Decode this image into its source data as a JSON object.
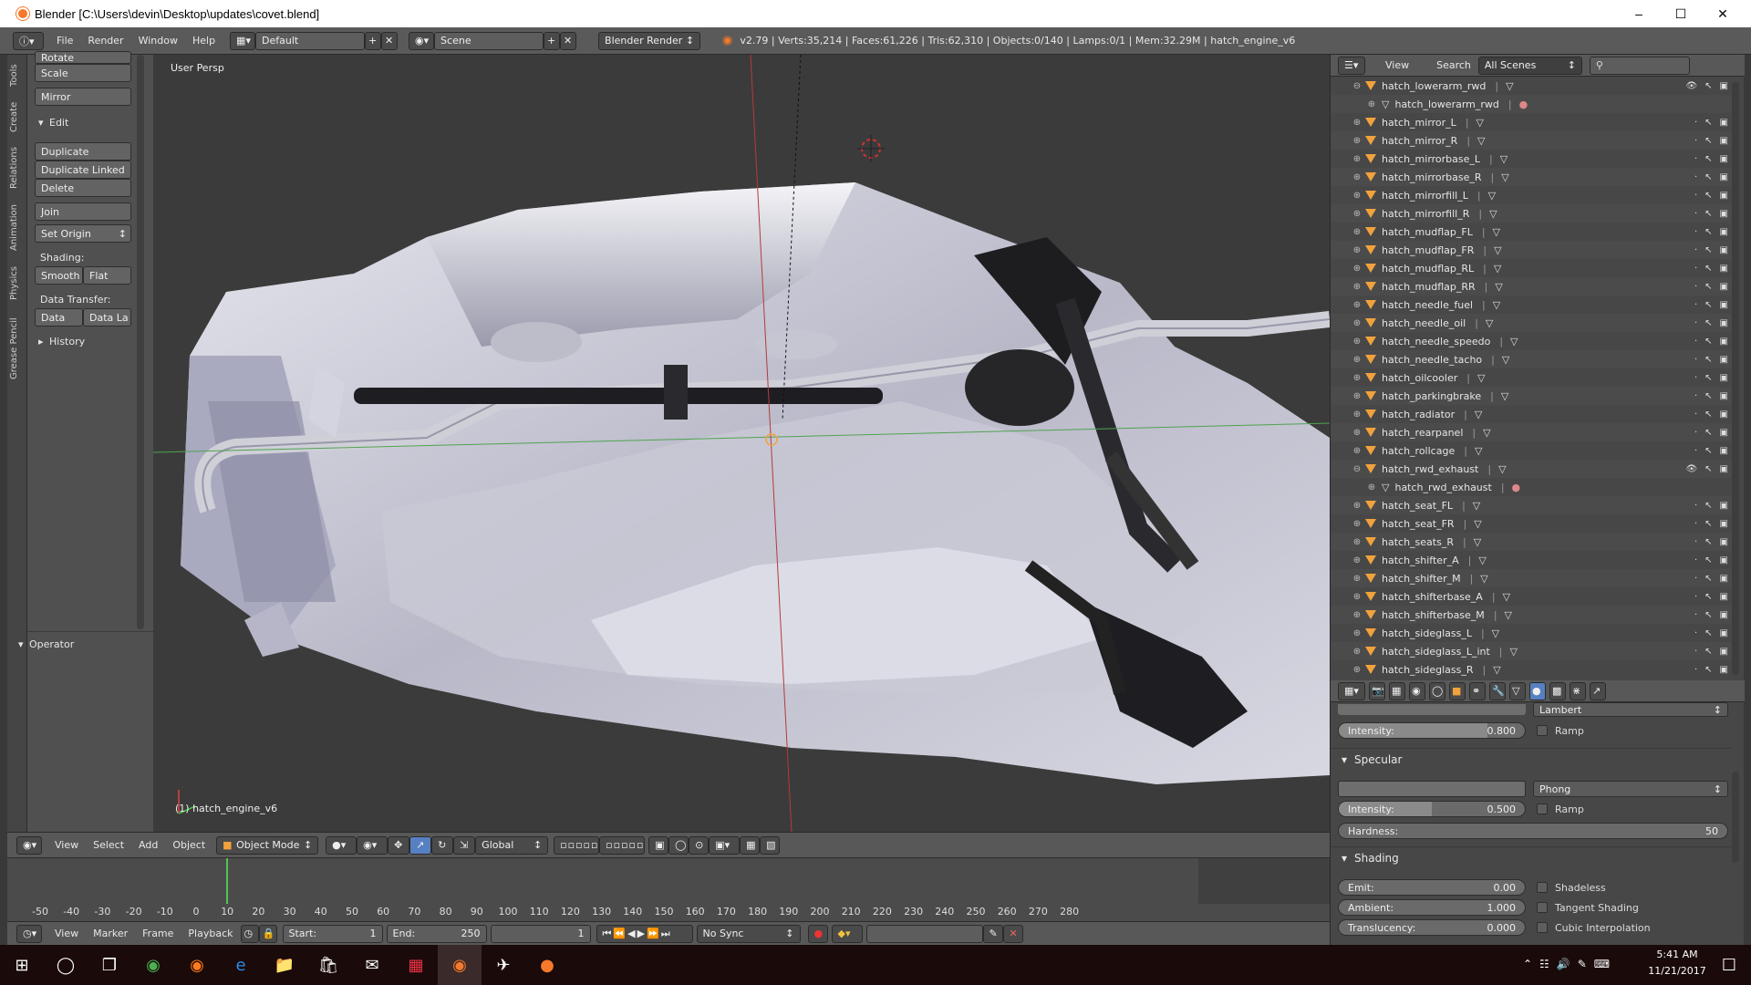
{
  "window": {
    "title": "Blender [C:\\Users\\devin\\Desktop\\updates\\covet.blend]"
  },
  "menu": [
    "File",
    "Render",
    "Window",
    "Help"
  ],
  "header": {
    "layout": "Default",
    "scene": "Scene",
    "engine": "Blender Render",
    "stats": "v2.79 | Verts:35,214 | Faces:61,226 | Tris:62,310 | Objects:0/140 | Lamps:0/1 | Mem:32.29M | hatch_engine_v6"
  },
  "tool_tabs": [
    "Tools",
    "Create",
    "Relations",
    "Animation",
    "Physics",
    "Grease Pencil"
  ],
  "tools": {
    "rotate": "Rotate",
    "scale": "Scale",
    "mirror": "Mirror",
    "edit_header": "Edit",
    "duplicate": "Duplicate",
    "duplicate_linked": "Duplicate Linked",
    "delete": "Delete",
    "join": "Join",
    "set_origin": "Set Origin",
    "shading_label": "Shading:",
    "smooth": "Smooth",
    "flat": "Flat",
    "data_transfer_label": "Data Transfer:",
    "data": "Data",
    "data_la": "Data La",
    "history": "History",
    "operator": "Operator"
  },
  "viewport": {
    "label": "User Persp",
    "object": "(1) hatch_engine_v6"
  },
  "view_header": {
    "view": "View",
    "select": "Select",
    "add": "Add",
    "object": "Object",
    "mode": "Object Mode",
    "orientation": "Global"
  },
  "timeline": {
    "ticks": [
      "-50",
      "-40",
      "-30",
      "-20",
      "-10",
      "0",
      "10",
      "20",
      "30",
      "40",
      "50",
      "60",
      "70",
      "80",
      "90",
      "100",
      "110",
      "120",
      "130",
      "140",
      "150",
      "160",
      "170",
      "180",
      "190",
      "200",
      "210",
      "220",
      "230",
      "240",
      "250",
      "260",
      "270",
      "280"
    ],
    "view": "View",
    "marker": "Marker",
    "frame": "Frame",
    "playback": "Playback",
    "start_label": "Start:",
    "start": "1",
    "end_label": "End:",
    "end": "250",
    "current": "1",
    "sync": "No Sync"
  },
  "outliner": {
    "view": "View",
    "search": "Search",
    "filter": "All Scenes",
    "rows": [
      {
        "name": "hatch_lowerarm_rwd",
        "child": false,
        "expanded": true
      },
      {
        "name": "hatch_lowerarm_rwd",
        "child": true
      },
      {
        "name": "hatch_mirror_L",
        "child": false
      },
      {
        "name": "hatch_mirror_R",
        "child": false
      },
      {
        "name": "hatch_mirrorbase_L",
        "child": false
      },
      {
        "name": "hatch_mirrorbase_R",
        "child": false
      },
      {
        "name": "hatch_mirrorfill_L",
        "child": false
      },
      {
        "name": "hatch_mirrorfill_R",
        "child": false
      },
      {
        "name": "hatch_mudflap_FL",
        "child": false
      },
      {
        "name": "hatch_mudflap_FR",
        "child": false
      },
      {
        "name": "hatch_mudflap_RL",
        "child": false
      },
      {
        "name": "hatch_mudflap_RR",
        "child": false
      },
      {
        "name": "hatch_needle_fuel",
        "child": false
      },
      {
        "name": "hatch_needle_oil",
        "child": false
      },
      {
        "name": "hatch_needle_speedo",
        "child": false
      },
      {
        "name": "hatch_needle_tacho",
        "child": false
      },
      {
        "name": "hatch_oilcooler",
        "child": false
      },
      {
        "name": "hatch_parkingbrake",
        "child": false
      },
      {
        "name": "hatch_radiator",
        "child": false
      },
      {
        "name": "hatch_rearpanel",
        "child": false
      },
      {
        "name": "hatch_rollcage",
        "child": false
      },
      {
        "name": "hatch_rwd_exhaust",
        "child": false,
        "expanded": true
      },
      {
        "name": "hatch_rwd_exhaust",
        "child": true
      },
      {
        "name": "hatch_seat_FL",
        "child": false
      },
      {
        "name": "hatch_seat_FR",
        "child": false
      },
      {
        "name": "hatch_seats_R",
        "child": false
      },
      {
        "name": "hatch_shifter_A",
        "child": false
      },
      {
        "name": "hatch_shifter_M",
        "child": false
      },
      {
        "name": "hatch_shifterbase_A",
        "child": false
      },
      {
        "name": "hatch_shifterbase_M",
        "child": false
      },
      {
        "name": "hatch_sideglass_L",
        "child": false
      },
      {
        "name": "hatch_sideglass_L_int",
        "child": false
      },
      {
        "name": "hatch_sideglass_R",
        "child": false
      }
    ]
  },
  "properties": {
    "diffuse_shader": "Lambert",
    "diffuse_intensity_label": "Intensity:",
    "diffuse_intensity": "0.800",
    "diffuse_intensity_fraction": 0.8,
    "ramp": "Ramp",
    "specular_header": "Specular",
    "specular_shader": "Phong",
    "specular_intensity_label": "Intensity:",
    "specular_intensity": "0.500",
    "specular_intensity_fraction": 0.5,
    "hardness_label": "Hardness:",
    "hardness": "50",
    "shading_header": "Shading",
    "emit_label": "Emit:",
    "emit": "0.00",
    "ambient_label": "Ambient:",
    "ambient": "1.000",
    "translucency_label": "Translucency:",
    "translucency": "0.000",
    "shadeless": "Shadeless",
    "tangent_shading": "Tangent Shading",
    "cubic_interpolation": "Cubic Interpolation"
  },
  "taskbar": {
    "time": "5:41 AM",
    "date": "11/21/2017"
  }
}
